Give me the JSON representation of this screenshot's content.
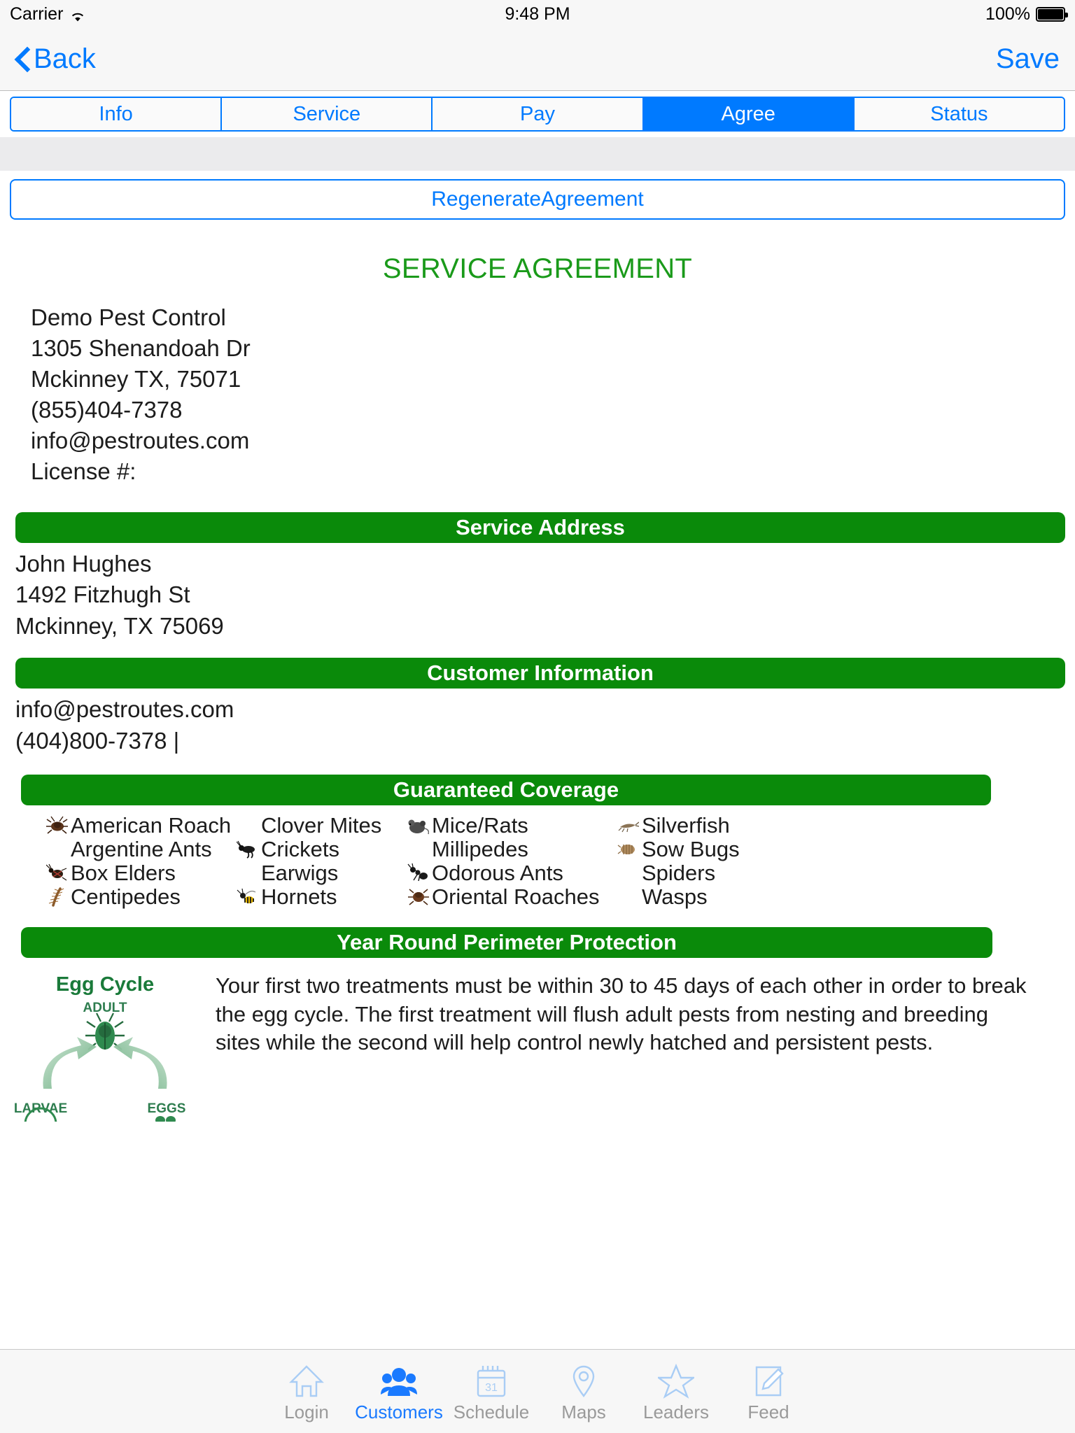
{
  "status_bar": {
    "carrier": "Carrier",
    "wifi_icon": "wifi-icon",
    "time": "9:48 PM",
    "battery_percent": "100%",
    "battery_icon": "battery-full-icon"
  },
  "nav_bar": {
    "back_label": "Back",
    "back_icon": "chevron-left-icon",
    "save_label": "Save"
  },
  "segmented_control": {
    "tabs": [
      {
        "label": "Info",
        "active": false
      },
      {
        "label": "Service",
        "active": false
      },
      {
        "label": "Pay",
        "active": false
      },
      {
        "label": "Agree",
        "active": true
      },
      {
        "label": "Status",
        "active": false
      }
    ]
  },
  "actions": {
    "regenerate_label": "RegenerateAgreement"
  },
  "document": {
    "title": "SERVICE AGREEMENT",
    "title_color": "#1a9a1a",
    "company": {
      "name": "Demo Pest Control",
      "street": "1305 Shenandoah Dr",
      "city_state_zip": "Mckinney TX, 75071",
      "phone": "(855)404-7378",
      "email": "info@pestroutes.com",
      "license": "License #:"
    },
    "service_address": {
      "header": "Service Address",
      "name": "John Hughes",
      "street": "1492 Fitzhugh St",
      "city_state_zip": "Mckinney, TX 75069"
    },
    "customer_information": {
      "header": "Customer Information",
      "email": "info@pestroutes.com",
      "phone": "(404)800-7378 |"
    },
    "guaranteed_coverage": {
      "header": "Guaranteed Coverage",
      "columns": [
        [
          {
            "name": "American Roach",
            "icon": "roach-icon",
            "has_icon": true
          },
          {
            "name": "Argentine Ants",
            "icon": "",
            "has_icon": false
          },
          {
            "name": "Box Elders",
            "icon": "box-elder-bug-icon",
            "has_icon": true
          },
          {
            "name": "Centipedes",
            "icon": "centipede-icon",
            "has_icon": true
          }
        ],
        [
          {
            "name": "Clover Mites",
            "icon": "",
            "has_icon": false
          },
          {
            "name": "Crickets",
            "icon": "cricket-icon",
            "has_icon": true
          },
          {
            "name": "Earwigs",
            "icon": "",
            "has_icon": false
          },
          {
            "name": "Hornets",
            "icon": "hornet-icon",
            "has_icon": true
          }
        ],
        [
          {
            "name": "Mice/Rats",
            "icon": "mouse-icon",
            "has_icon": true
          },
          {
            "name": "Millipedes",
            "icon": "",
            "has_icon": false
          },
          {
            "name": "Odorous Ants",
            "icon": "ant-icon",
            "has_icon": true
          },
          {
            "name": "Oriental Roaches",
            "icon": "oriental-roach-icon",
            "has_icon": true
          }
        ],
        [
          {
            "name": "Silverfish",
            "icon": "silverfish-icon",
            "has_icon": true
          },
          {
            "name": "Sow Bugs",
            "icon": "sow-bug-icon",
            "has_icon": true
          },
          {
            "name": "Spiders",
            "icon": "",
            "has_icon": false
          },
          {
            "name": "Wasps",
            "icon": "",
            "has_icon": false
          }
        ]
      ]
    },
    "year_round": {
      "header": "Year Round Perimeter Protection",
      "diagram": {
        "title": "Egg Cycle",
        "label_adult": "ADULT",
        "label_larvae": "LARVAE",
        "label_eggs": "EGGS"
      },
      "body": "Your first two treatments must be within 30 to 45 days of each other in order to break the egg cycle. The first treatment will flush adult pests from nesting and breeding sites while the second will help control newly hatched and persistent pests."
    }
  },
  "tab_bar": {
    "items": [
      {
        "label": "Login",
        "icon": "home-icon",
        "active": false
      },
      {
        "label": "Customers",
        "icon": "people-icon",
        "active": true
      },
      {
        "label": "Schedule",
        "icon": "calendar-31-icon",
        "active": false
      },
      {
        "label": "Maps",
        "icon": "map-pin-icon",
        "active": false
      },
      {
        "label": "Leaders",
        "icon": "star-icon",
        "active": false
      },
      {
        "label": "Feed",
        "icon": "pencil-note-icon",
        "active": false
      }
    ]
  },
  "colors": {
    "accent_blue": "#007aff",
    "section_green": "#0a8a0a",
    "title_green": "#1a9a1a"
  }
}
